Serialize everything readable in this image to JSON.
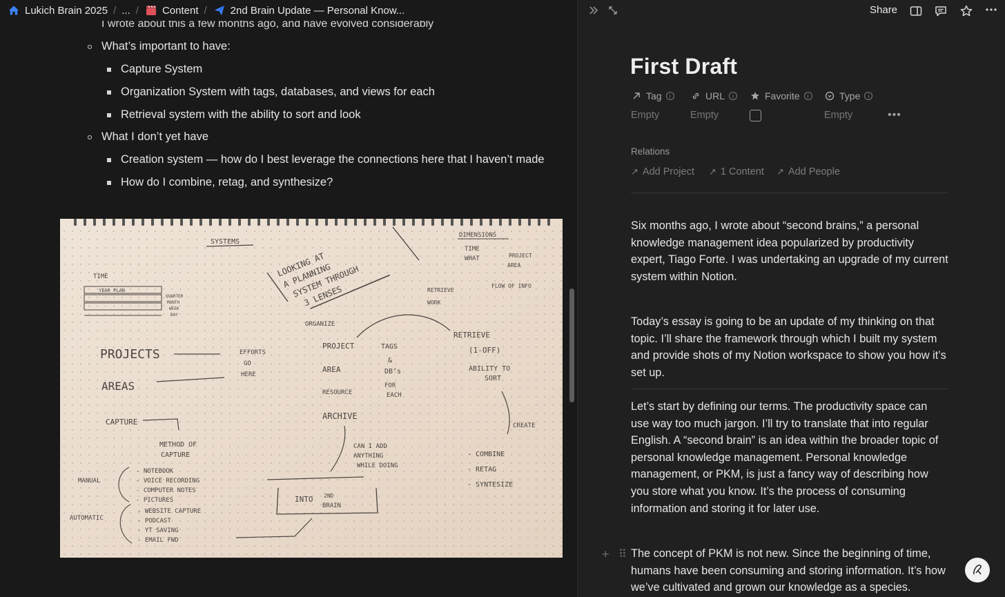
{
  "breadcrumb": {
    "items": [
      {
        "label": "Lukich Brain 2025",
        "icon": "house-icon"
      },
      {
        "label": "...",
        "icon": ""
      },
      {
        "label": "Content",
        "icon": "clapper-icon"
      },
      {
        "label": "2nd Brain Update — Personal Know...",
        "icon": "paper-plane-icon"
      }
    ],
    "separator": "/"
  },
  "left_doc": {
    "cut_line": "I wrote about this a few months ago, and have evolved considerably",
    "bullets": [
      {
        "level": 1,
        "text": "What’s important to have:"
      },
      {
        "level": 2,
        "text": "Capture System"
      },
      {
        "level": 2,
        "text": "Organization System with tags, databases, and views for each"
      },
      {
        "level": 2,
        "text": "Retrieval system with the ability to sort and look"
      },
      {
        "level": 1,
        "text": "What I don’t yet have"
      },
      {
        "level": 2,
        "text": "Creation system — how do I best leverage the connections here that I haven’t made"
      },
      {
        "level": 2,
        "text": "How do I combine, retag, and synthesize?"
      }
    ],
    "notebook_image": {
      "description_icon": "handwritten-notebook-image",
      "handwriting": {
        "systems": "SYSTEMS",
        "looking_at": "LOOKING AT",
        "a_planning": "A PLANNING",
        "system_through": "SYSTEM THROUGH",
        "three_lenses": "3 LENSES",
        "dimensions": "DIMENSIONS",
        "time": "TIME",
        "what": "WHAT",
        "project": "PROJECT",
        "area": "AREA",
        "time_left": "TIME",
        "year_plan": "YEAR PLAN",
        "quarter": "QUARTER",
        "month": "MONTH",
        "week": "WEEK",
        "day": "DAY",
        "retrieve_work": "RETRIEVE",
        "work": "WORK",
        "flow_of_info": "FLOW OF INFO",
        "organize": "ORGANIZE",
        "retrieve": "RETRIEVE",
        "one_off": "(1-OFF)",
        "ability_to": "ABILITY TO",
        "sort": "SORT",
        "projects": "PROJECTS",
        "efforts": "EFFORTS",
        "go": "GO",
        "here": "HERE",
        "areas": "AREAS",
        "project_mid": "PROJECT",
        "area_mid": "AREA",
        "resource": "RESOURCE",
        "archive": "ARCHIVE",
        "tags": "TAGS",
        "and": "&",
        "dbs": "DB’s",
        "for": "FOR",
        "each": "EACH",
        "capture": "CAPTURE",
        "method_of": "METHOD OF",
        "capture2": "CAPTURE",
        "manual": "MANUAL",
        "automatic": "AUTOMATIC",
        "m1": "- NOTEBOOK",
        "m2": "- VOICE RECORDING",
        "m3": "- COMPUTER NOTES",
        "m4": "- PICTURES",
        "a1": "- WEBSITE CAPTURE",
        "a2": "- PODCAST",
        "a3": "- YT SAVING",
        "a4": "- EMAIL FWD",
        "can_i_add": "CAN I ADD",
        "anything": "ANYTHING",
        "while_doing": "WHILE DOING",
        "into": "INTO",
        "second": "2ND",
        "brain": "BRAIN",
        "create": "CREATE",
        "combine": "- COMBINE",
        "retag": "- RETAG",
        "synthesize": "- SYNTESIZE"
      }
    }
  },
  "right_toolbar": {
    "share_label": "Share",
    "icons": [
      "double-chevron-right-icon",
      "expand-icon",
      "sidebar-toggle-icon",
      "comments-icon",
      "star-icon",
      "more-icon"
    ]
  },
  "page": {
    "title": "First Draft",
    "properties": [
      {
        "name": "Tag",
        "icon": "arrow-up-right-icon",
        "value": "Empty"
      },
      {
        "name": "URL",
        "icon": "link-icon",
        "value": "Empty"
      },
      {
        "name": "Favorite",
        "icon": "star-filled-icon",
        "value": ""
      },
      {
        "name": "Type",
        "icon": "status-icon",
        "value": "Empty"
      }
    ],
    "more_label": "•••",
    "relations_heading": "Relations",
    "relations": [
      {
        "label": "Add Project"
      },
      {
        "label": "1 Content"
      },
      {
        "label": "Add People"
      }
    ],
    "paragraphs": [
      "Six months ago, I wrote about “second brains,” a personal knowledge management idea popularized by productivity expert, Tiago Forte. I was undertaking an upgrade of my current system within Notion.",
      "Today’s essay is going to be an update of my thinking on that topic. I’ll share the framework through which I built my system and provide shots of my Notion workspace to show you how it’s set up.",
      "Let’s start by defining our terms. The productivity space can use way too much jargon. I’ll try to translate that into regular English. A “second brain” is an idea within the broader topic of personal knowledge management. Personal knowledge management, or PKM, is just a fancy way of describing how you store what you know. It’s the process of consuming information and storing it for later use.",
      "The concept of PKM is not new. Since the beginning of time, humans have been consuming and storing information. It’s how we’ve cultivated and grown our knowledge as a species."
    ],
    "help_icon": "help-pen-icon"
  }
}
